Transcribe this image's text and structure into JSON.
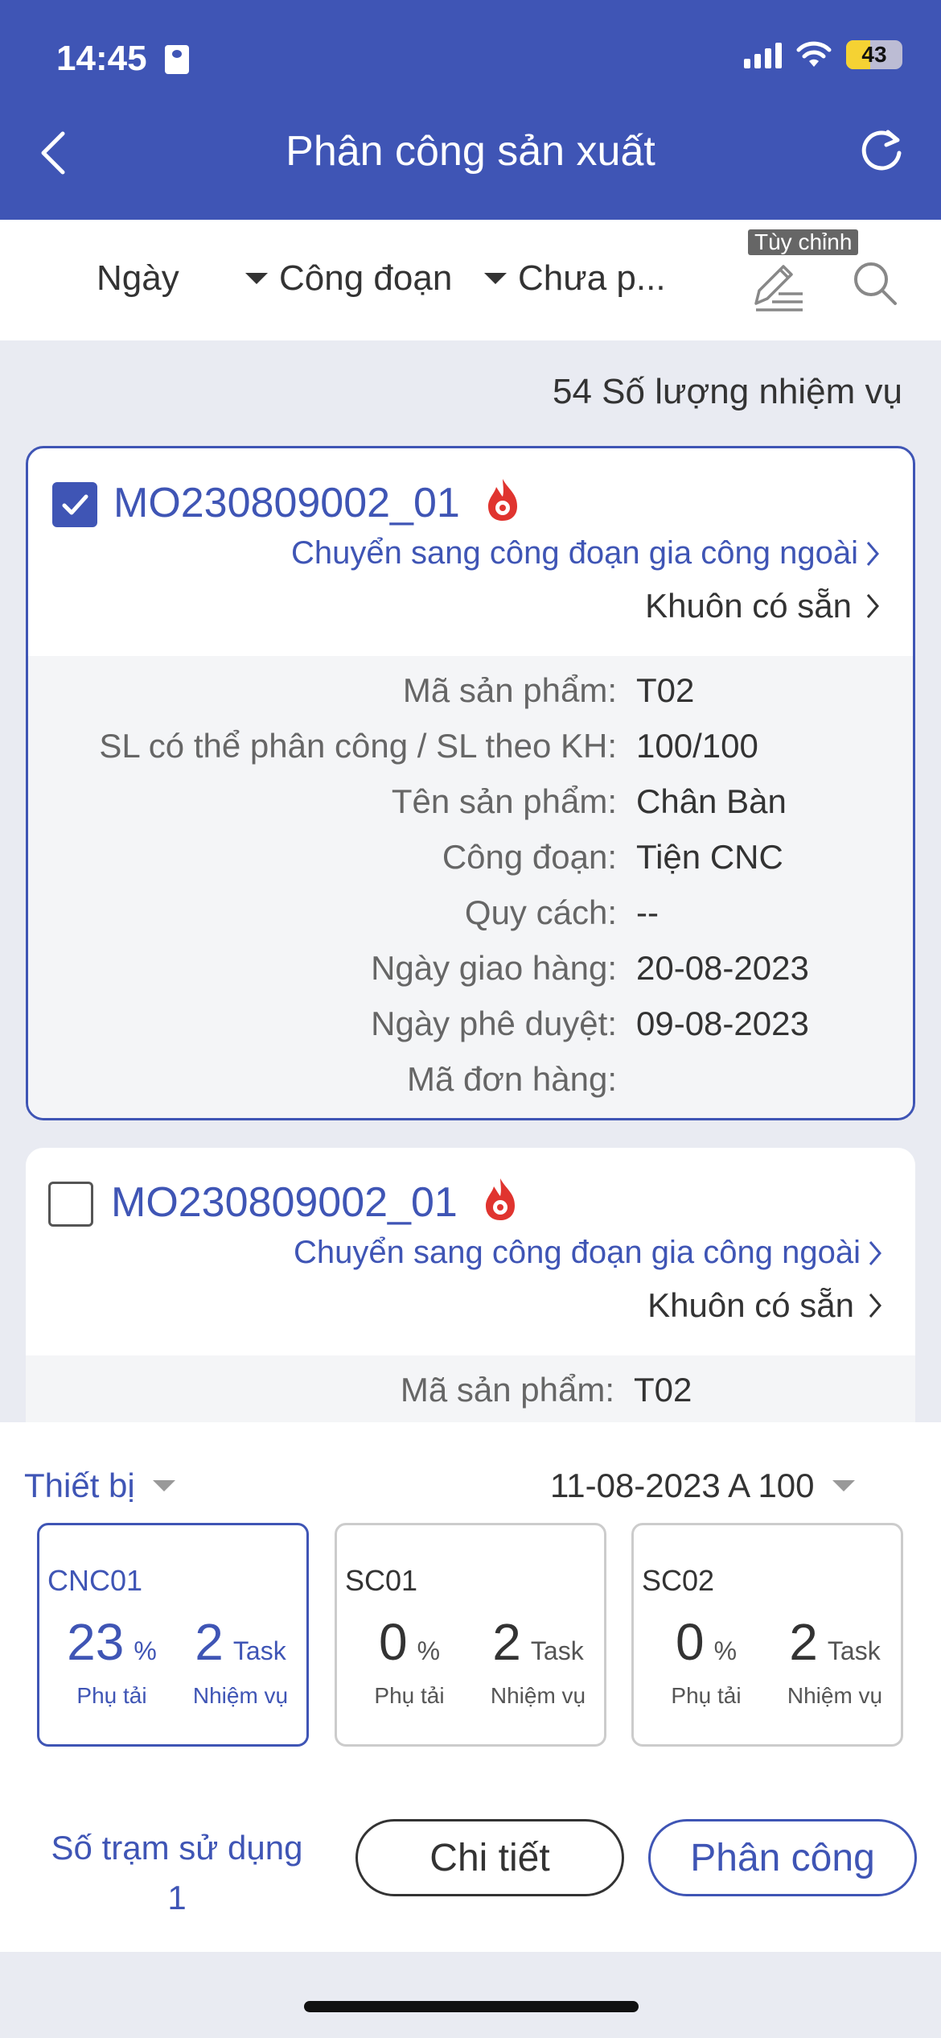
{
  "status_bar": {
    "time": "14:45",
    "battery": "43"
  },
  "nav": {
    "title": "Phân công sản xuất"
  },
  "filters": {
    "date": "Ngày",
    "stage": "Công đoạn",
    "status": "Chưa p...",
    "customize_tooltip": "Tùy chỉnh"
  },
  "task_count": "54 Số lượng nhiệm vụ",
  "cards": [
    {
      "code": "MO230809002_01",
      "outsource_link": "Chuyển sang công đoạn gia công ngoài",
      "mold_link": "Khuôn có sẵn",
      "rows": [
        {
          "label": "Mã sản phẩm:",
          "value": "T02"
        },
        {
          "label": "SL có thể phân công / SL theo KH:",
          "value": "100/100"
        },
        {
          "label": "Tên sản phẩm:",
          "value": "Chân Bàn"
        },
        {
          "label": "Công đoạn:",
          "value": "Tiện CNC"
        },
        {
          "label": "Quy cách:",
          "value": "--"
        },
        {
          "label": "Ngày giao hàng:",
          "value": "20-08-2023"
        },
        {
          "label": "Ngày phê duyệt:",
          "value": "09-08-2023"
        },
        {
          "label": "Mã đơn hàng:",
          "value": ""
        }
      ]
    },
    {
      "code": "MO230809002_01",
      "outsource_link": "Chuyển sang công đoạn gia công ngoài",
      "mold_link": "Khuôn có sẵn",
      "rows": [
        {
          "label": "Mã sản phẩm:",
          "value": "T02"
        }
      ]
    }
  ],
  "sheet": {
    "device_label": "Thiết bị",
    "date_shift": "11-08-2023 A 100",
    "machines": [
      {
        "name": "CNC01",
        "load": "23",
        "load_unit": "%",
        "load_caption": "Phụ tải",
        "tasks": "2",
        "tasks_unit": "Task",
        "tasks_caption": "Nhiệm vụ"
      },
      {
        "name": "SC01",
        "load": "0",
        "load_unit": "%",
        "load_caption": "Phụ tải",
        "tasks": "2",
        "tasks_unit": "Task",
        "tasks_caption": "Nhiệm vụ"
      },
      {
        "name": "SC02",
        "load": "0",
        "load_unit": "%",
        "load_caption": "Phụ tải",
        "tasks": "2",
        "tasks_unit": "Task",
        "tasks_caption": "Nhiệm vụ"
      }
    ]
  },
  "footer": {
    "stations_label": "Số trạm sử dụng",
    "stations_value": "1",
    "detail_button": "Chi tiết",
    "assign_button": "Phân công"
  }
}
